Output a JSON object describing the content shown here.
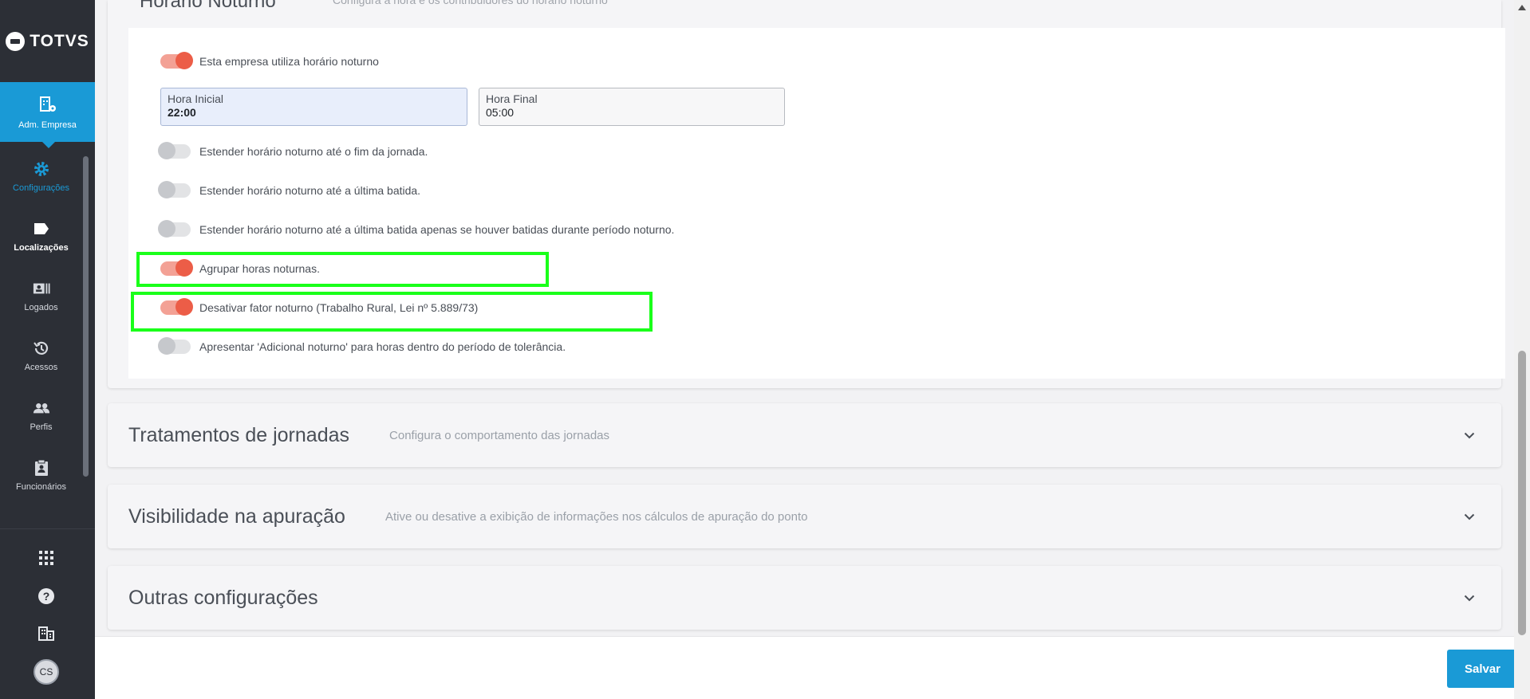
{
  "sidebar": {
    "brand": "TOTVS",
    "active": {
      "label": "Adm. Empresa"
    },
    "items": [
      {
        "label": "Configurações"
      },
      {
        "label": "Localizações"
      },
      {
        "label": "Logados"
      },
      {
        "label": "Acessos"
      },
      {
        "label": "Perfis"
      },
      {
        "label": "Funcionários"
      }
    ],
    "user_initials": "CS"
  },
  "section": {
    "title": "Horário Noturno",
    "description": "Configura a hora e os contribuidores do horário noturno"
  },
  "settings": {
    "uses_night": {
      "label": "Esta empresa utiliza horário noturno",
      "on": true
    },
    "start": {
      "label": "Hora Inicial",
      "value": "22:00"
    },
    "end": {
      "label": "Hora Final",
      "value": "05:00"
    },
    "toggles": [
      {
        "label": "Estender horário noturno até o fim da jornada.",
        "on": false
      },
      {
        "label": "Estender horário noturno até a última batida.",
        "on": false
      },
      {
        "label": "Estender horário noturno até a última batida apenas se houver batidas durante período noturno.",
        "on": false
      },
      {
        "label": "Agrupar horas noturnas.",
        "on": true
      },
      {
        "label": "Desativar fator noturno (Trabalho Rural, Lei nº 5.889/73)",
        "on": true
      },
      {
        "label": "Apresentar 'Adicional noturno' para horas dentro do período de tolerância.",
        "on": false
      }
    ]
  },
  "accordions": [
    {
      "title": "Tratamentos de jornadas",
      "description": "Configura o comportamento das jornadas"
    },
    {
      "title": "Visibilidade na apuração",
      "description": "Ative ou desative a exibição de informações nos cálculos de apuração do ponto"
    },
    {
      "title": "Outras configurações",
      "description": ""
    }
  ],
  "footer": {
    "save_label": "Salvar"
  },
  "colors": {
    "accent": "#1a9ad6",
    "toggle_on": "#ec5d47",
    "highlight": "#1aff1a",
    "sidebar": "#2c2f36"
  }
}
